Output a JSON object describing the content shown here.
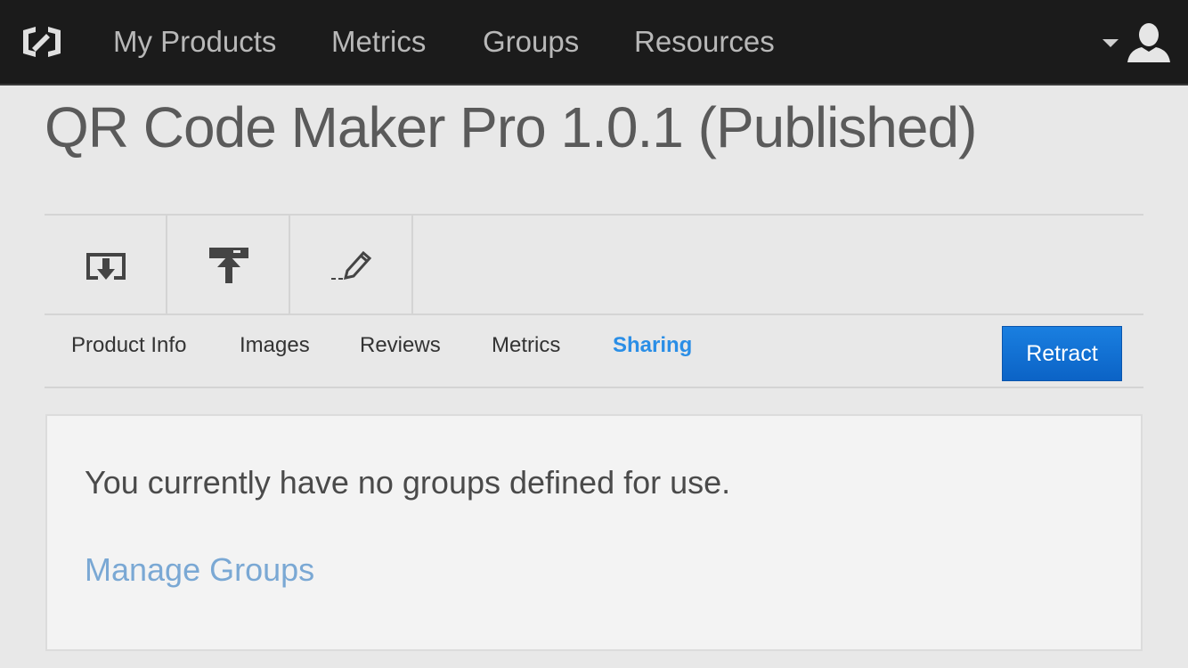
{
  "nav": {
    "logo_icon": "creative-cloud-logo-icon",
    "items": [
      "My Products",
      "Metrics",
      "Groups",
      "Resources"
    ],
    "user_icon": "user-avatar-icon"
  },
  "page": {
    "title": "QR Code Maker Pro 1.0.1 (Published)"
  },
  "toolbar": {
    "icons": [
      "download-icon",
      "publish-upload-icon",
      "edit-pencil-icon"
    ]
  },
  "tabs": {
    "items": [
      "Product Info",
      "Images",
      "Reviews",
      "Metrics",
      "Sharing"
    ],
    "active": "Sharing",
    "retract_label": "Retract"
  },
  "sharing": {
    "message": "You currently have no groups defined for use.",
    "link": "Manage Groups"
  },
  "colors": {
    "topbar": "#1b1b1b",
    "accent": "#2a8ee6",
    "button": "#0b63c6",
    "link": "#7aa8d4"
  }
}
